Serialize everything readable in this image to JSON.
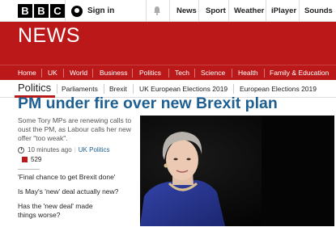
{
  "brand": {
    "letters": [
      "B",
      "B",
      "C"
    ]
  },
  "topbar": {
    "sign_in": "Sign in",
    "nav": [
      "News",
      "Sport",
      "Weather",
      "iPlayer",
      "Sounds"
    ]
  },
  "banner": {
    "title": "NEWS"
  },
  "main_nav": [
    "Home",
    "UK",
    "World",
    "Business",
    "Politics",
    "Tech",
    "Science",
    "Health",
    "Family & Education"
  ],
  "sub_nav": {
    "title": "Politics",
    "items": [
      "Parliaments",
      "Brexit",
      "UK European Elections 2019",
      "European Elections 2019"
    ]
  },
  "article": {
    "headline": "PM under fire over new Brexit plan",
    "summary": "Some Tory MPs are renewing calls to oust the PM, as Labour calls her new offer \"too weak\".",
    "time": "10 minutes ago",
    "section": "UK Politics",
    "comment_count": "529",
    "related": [
      "'Final chance to get Brexit done'",
      "Is May's 'new' deal actually new?",
      "Has the 'new deal' made things worse?"
    ]
  },
  "colors": {
    "brand_red": "#bb1919",
    "headline_blue": "#1d5f91"
  },
  "icons": {
    "user": "user-icon",
    "bell": "bell-icon",
    "clock": "clock-icon",
    "comment": "comment-icon"
  }
}
